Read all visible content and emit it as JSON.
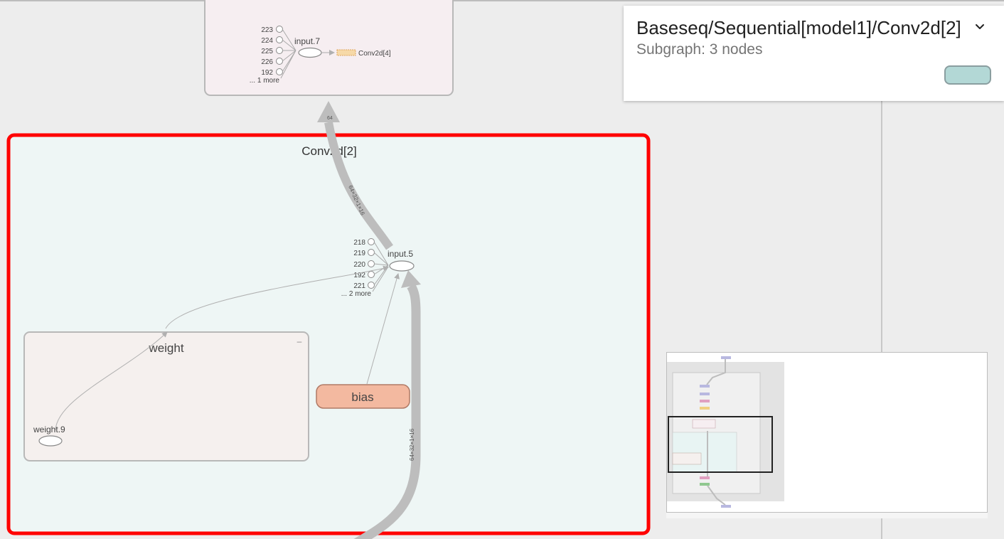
{
  "info_card": {
    "title": "Baseseq/Sequential[model1]/Conv2d[2]",
    "subtitle": "Subgraph: 3 nodes",
    "swatch_color": "#b3d8d6",
    "expand_icon": "chevron-down-icon"
  },
  "graph": {
    "selected_color": "#ff0000",
    "upper_group": {
      "node": "input.7",
      "inputs": [
        "223",
        "224",
        "225",
        "226",
        "192"
      ],
      "more": "... 1 more",
      "target": "Conv2d[4]"
    },
    "conv_group": {
      "title": "Conv2d[2]",
      "node": "input.5",
      "inputs": [
        "218",
        "219",
        "220",
        "192",
        "221"
      ],
      "more": "... 2 more",
      "edge_label_out": "64×32×1×16",
      "edge_label_in": "64×32×1×16",
      "weight_group": {
        "title": "weight",
        "node": "weight.9",
        "collapse_label": "–"
      },
      "bias_label": "bias"
    }
  }
}
